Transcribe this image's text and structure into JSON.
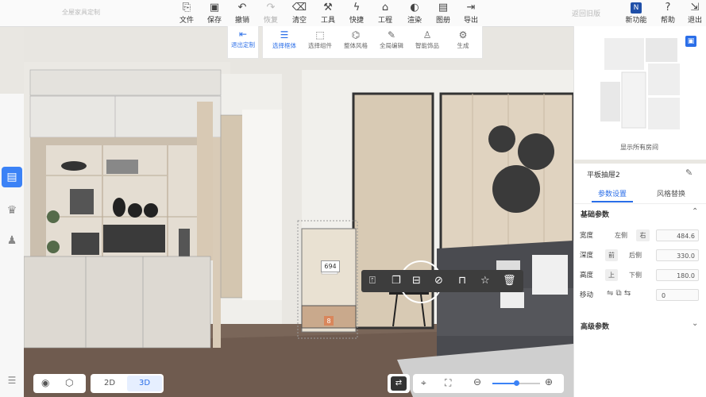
{
  "app": {
    "title": "全屋家具定制",
    "back_to_old": "返回旧版"
  },
  "toolbar": {
    "items": [
      {
        "label": "文件",
        "icon": "file-icon",
        "glyph": "⎘"
      },
      {
        "label": "保存",
        "icon": "save-icon",
        "glyph": "▣"
      },
      {
        "label": "撤销",
        "icon": "undo-icon",
        "glyph": "↶"
      },
      {
        "label": "恢复",
        "icon": "redo-icon",
        "glyph": "↷",
        "disabled": true
      },
      {
        "label": "清空",
        "icon": "eraser-icon",
        "glyph": "⌫"
      },
      {
        "label": "工具",
        "icon": "wrench-icon",
        "glyph": "⚒"
      },
      {
        "label": "快捷",
        "icon": "lightning-icon",
        "glyph": "ϟ"
      },
      {
        "label": "工程",
        "icon": "project-icon",
        "glyph": "⌂"
      },
      {
        "label": "渲染",
        "icon": "render-icon",
        "glyph": "◐"
      },
      {
        "label": "图册",
        "icon": "album-icon",
        "glyph": "▤"
      },
      {
        "label": "导出",
        "icon": "export-icon",
        "glyph": "⇥"
      }
    ],
    "right": [
      {
        "label": "新功能",
        "icon": "new-feature-icon",
        "glyph": "N"
      },
      {
        "label": "帮助",
        "icon": "help-icon",
        "glyph": "?"
      },
      {
        "label": "退出",
        "icon": "logout-icon",
        "glyph": "⇲"
      }
    ]
  },
  "subtoolbar": {
    "exit_label": "退出定制",
    "items": [
      {
        "label": "选择框体",
        "icon": "select-cabinet-icon",
        "glyph": "☰",
        "active": true
      },
      {
        "label": "选择组件",
        "icon": "select-component-icon",
        "glyph": "⬚"
      },
      {
        "label": "整体风格",
        "icon": "style-icon",
        "glyph": "⌬"
      },
      {
        "label": "全局编辑",
        "icon": "global-edit-icon",
        "glyph": "✎"
      },
      {
        "label": "智能饰品",
        "icon": "smart-decor-icon",
        "glyph": "♙"
      },
      {
        "label": "生成",
        "icon": "generate-icon",
        "glyph": "⚙"
      }
    ]
  },
  "minimap": {
    "show_all_label": "显示所有房间"
  },
  "props": {
    "title": "平板抽屉2",
    "tabs": [
      {
        "label": "参数设置",
        "active": true
      },
      {
        "label": "风格替换",
        "active": false
      }
    ],
    "basic_section": "基础参数",
    "advanced_section": "高级参数",
    "rows": [
      {
        "label": "宽度",
        "opt_a": "左侧",
        "opt_b": "右",
        "value": "484.6"
      },
      {
        "label": "深度",
        "opt_a": "前",
        "opt_b": "后侧",
        "value": "330.0"
      },
      {
        "label": "高度",
        "opt_a": "上",
        "opt_b": "下侧",
        "value": "180.0"
      },
      {
        "label": "移动",
        "value": "0"
      }
    ]
  },
  "scene": {
    "dim_upper": "694",
    "dim_lower": "8"
  },
  "bottom": {
    "view_2d": "2D",
    "view_3d": "3D",
    "zoom_level": 0.5
  },
  "colors": {
    "accent": "#2a6ee8",
    "active_rail": "#3b82f6",
    "dim_highlight": "#d9865b"
  }
}
